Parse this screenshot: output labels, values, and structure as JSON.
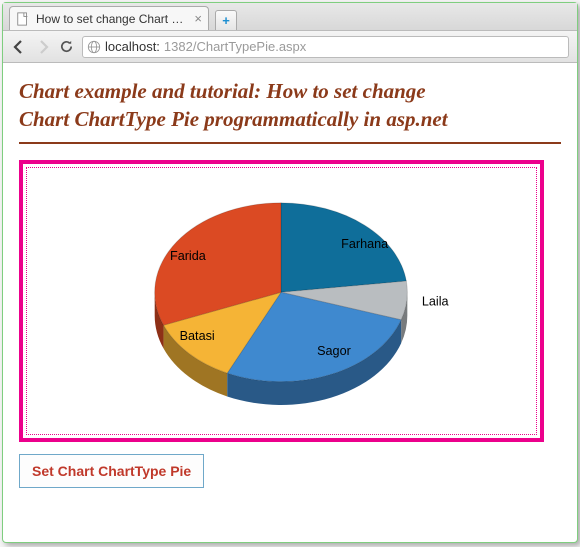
{
  "browser": {
    "tab_title": "How to set change Chart C...",
    "url_host": "localhost:",
    "url_port_path": "1382/ChartTypePie.aspx"
  },
  "page": {
    "title_line1": "Chart example and tutorial: How to set change",
    "title_line2": "Chart ChartType Pie programmatically in asp.net",
    "button_label": "Set Chart ChartType Pie"
  },
  "chart_data": {
    "type": "pie",
    "title": "",
    "series": [
      {
        "name": "Farhana",
        "value": 23,
        "color": "#0f6e9a"
      },
      {
        "name": "Laila",
        "value": 7,
        "color": "#b9bdc0"
      },
      {
        "name": "Sagor",
        "value": 27,
        "color": "#3f89cf"
      },
      {
        "name": "Batasi",
        "value": 12,
        "color": "#f5b436"
      },
      {
        "name": "Farida",
        "value": 31,
        "color": "#db4a23"
      }
    ]
  },
  "colors": {
    "chart_border": "#ec008c",
    "title_color": "#8b3a1a",
    "button_text": "#c0392b",
    "button_border": "#6fa8c9"
  }
}
